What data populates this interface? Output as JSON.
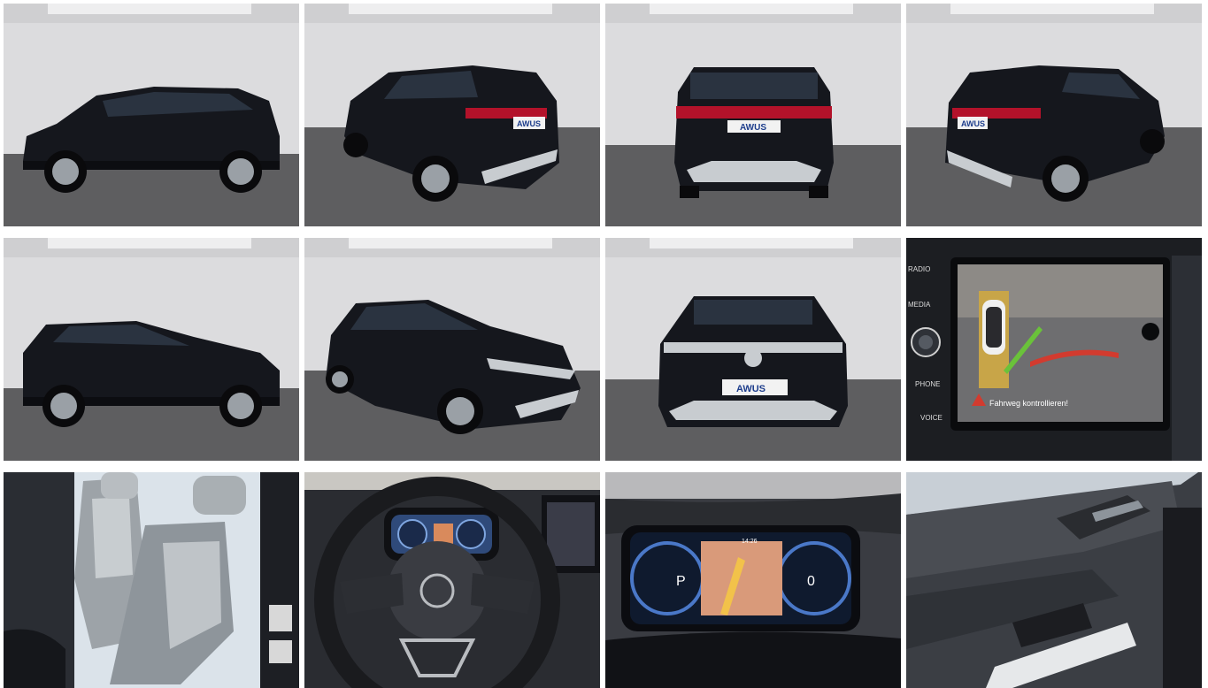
{
  "gallery": {
    "photos": [
      {
        "view": "side-left",
        "dealer_plate": ""
      },
      {
        "view": "rear-left-angle",
        "dealer_plate": "AWUS"
      },
      {
        "view": "rear",
        "dealer_plate": "AWUS"
      },
      {
        "view": "rear-right-angle",
        "dealer_plate": "AWUS"
      },
      {
        "view": "side-right",
        "dealer_plate": ""
      },
      {
        "view": "front-left-angle",
        "dealer_plate": ""
      },
      {
        "view": "front",
        "dealer_plate": "AWUS"
      },
      {
        "view": "infotainment-rear-camera",
        "dealer_plate": ""
      },
      {
        "view": "front-seats",
        "dealer_plate": ""
      },
      {
        "view": "steering-wheel",
        "dealer_plate": ""
      },
      {
        "view": "digital-cockpit",
        "dealer_plate": ""
      },
      {
        "view": "door-panel",
        "dealer_plate": ""
      }
    ]
  },
  "infotainment": {
    "menu": [
      "RADIO",
      "MEDIA",
      "PHONE",
      "VOICE"
    ],
    "warning": "Fahrweg kontrollieren!"
  },
  "cockpit": {
    "gear": "P",
    "speed": "0",
    "time": "14:26"
  },
  "colors": {
    "car_body": "#14161c",
    "studio_wall": "#d9d9db",
    "studio_floor": "#5c5c5e",
    "trim_silver": "#c8ccd0",
    "taillight": "#b3122a"
  }
}
